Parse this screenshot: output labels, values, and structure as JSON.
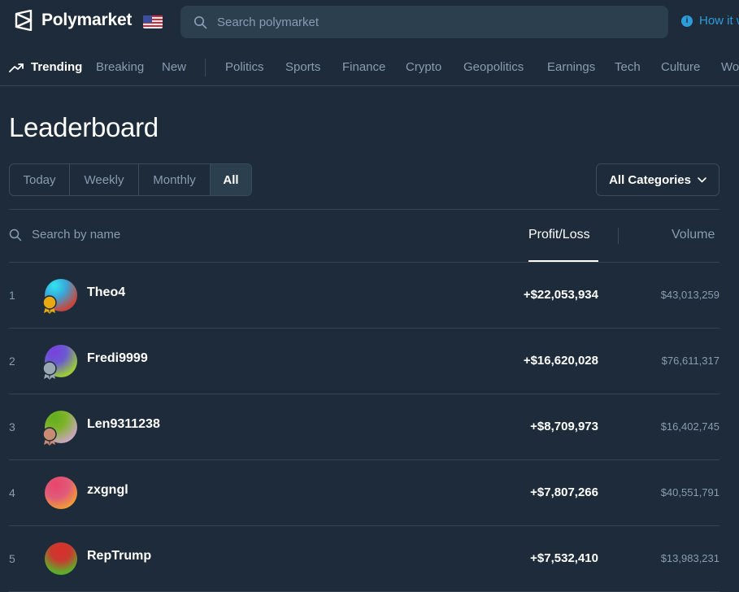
{
  "header": {
    "logo_text": "Polymarket",
    "flag_icon": "us-flag-icon",
    "search_placeholder": "Search polymarket",
    "how_it_works": "How it w"
  },
  "nav": {
    "trending": "Trending",
    "breaking": "Breaking",
    "new": "New",
    "politics": "Politics",
    "sports": "Sports",
    "finance": "Finance",
    "crypto": "Crypto",
    "geopolitics": "Geopolitics",
    "earnings": "Earnings",
    "tech": "Tech",
    "culture": "Culture",
    "world": "Wo"
  },
  "page": {
    "title": "Leaderboard",
    "tabs": [
      "Today",
      "Weekly",
      "Monthly",
      "All"
    ],
    "selected_tab": "All",
    "category_dropdown": "All Categories",
    "name_search_placeholder": "Search by name",
    "col_profit_loss": "Profit/Loss",
    "col_volume": "Volume"
  },
  "rows": [
    {
      "rank": "1",
      "name": "Theo4",
      "pl": "+$22,053,934",
      "volume": "$43,013,259",
      "medal": "gold"
    },
    {
      "rank": "2",
      "name": "Fredi9999",
      "pl": "+$16,620,028",
      "volume": "$76,611,317",
      "medal": "silver"
    },
    {
      "rank": "3",
      "name": "Len9311238",
      "pl": "+$8,709,973",
      "volume": "$16,402,745",
      "medal": "bronze"
    },
    {
      "rank": "4",
      "name": "zxgngl",
      "pl": "+$7,807,266",
      "volume": "$40,551,791",
      "medal": ""
    },
    {
      "rank": "5",
      "name": "RepTrump",
      "pl": "+$7,532,410",
      "volume": "$13,983,231",
      "medal": ""
    }
  ],
  "colors": {
    "background": "#1d2b3a",
    "accent_blue": "#2d9cdb",
    "muted_text": "#899cb2",
    "gold": "#e8a912",
    "silver": "#9aa8b4",
    "bronze": "#c98a72"
  }
}
